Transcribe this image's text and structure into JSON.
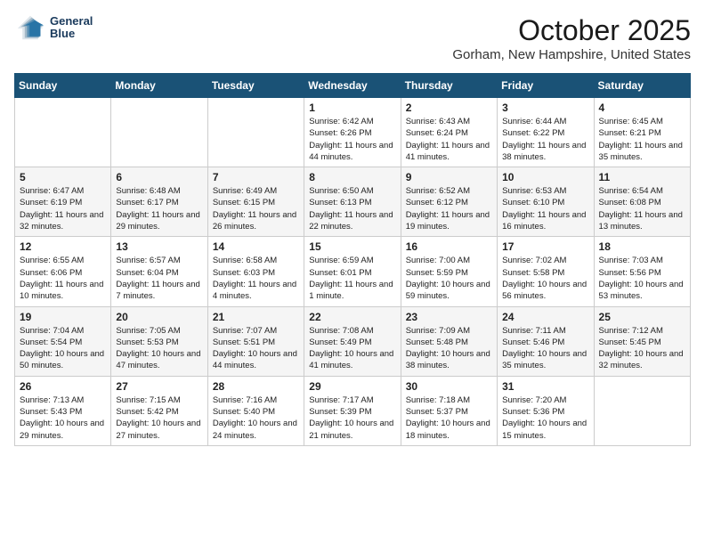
{
  "header": {
    "logo_line1": "General",
    "logo_line2": "Blue",
    "month": "October 2025",
    "location": "Gorham, New Hampshire, United States"
  },
  "weekdays": [
    "Sunday",
    "Monday",
    "Tuesday",
    "Wednesday",
    "Thursday",
    "Friday",
    "Saturday"
  ],
  "weeks": [
    [
      {
        "day": "",
        "sunrise": "",
        "sunset": "",
        "daylight": ""
      },
      {
        "day": "",
        "sunrise": "",
        "sunset": "",
        "daylight": ""
      },
      {
        "day": "",
        "sunrise": "",
        "sunset": "",
        "daylight": ""
      },
      {
        "day": "1",
        "sunrise": "Sunrise: 6:42 AM",
        "sunset": "Sunset: 6:26 PM",
        "daylight": "Daylight: 11 hours and 44 minutes."
      },
      {
        "day": "2",
        "sunrise": "Sunrise: 6:43 AM",
        "sunset": "Sunset: 6:24 PM",
        "daylight": "Daylight: 11 hours and 41 minutes."
      },
      {
        "day": "3",
        "sunrise": "Sunrise: 6:44 AM",
        "sunset": "Sunset: 6:22 PM",
        "daylight": "Daylight: 11 hours and 38 minutes."
      },
      {
        "day": "4",
        "sunrise": "Sunrise: 6:45 AM",
        "sunset": "Sunset: 6:21 PM",
        "daylight": "Daylight: 11 hours and 35 minutes."
      }
    ],
    [
      {
        "day": "5",
        "sunrise": "Sunrise: 6:47 AM",
        "sunset": "Sunset: 6:19 PM",
        "daylight": "Daylight: 11 hours and 32 minutes."
      },
      {
        "day": "6",
        "sunrise": "Sunrise: 6:48 AM",
        "sunset": "Sunset: 6:17 PM",
        "daylight": "Daylight: 11 hours and 29 minutes."
      },
      {
        "day": "7",
        "sunrise": "Sunrise: 6:49 AM",
        "sunset": "Sunset: 6:15 PM",
        "daylight": "Daylight: 11 hours and 26 minutes."
      },
      {
        "day": "8",
        "sunrise": "Sunrise: 6:50 AM",
        "sunset": "Sunset: 6:13 PM",
        "daylight": "Daylight: 11 hours and 22 minutes."
      },
      {
        "day": "9",
        "sunrise": "Sunrise: 6:52 AM",
        "sunset": "Sunset: 6:12 PM",
        "daylight": "Daylight: 11 hours and 19 minutes."
      },
      {
        "day": "10",
        "sunrise": "Sunrise: 6:53 AM",
        "sunset": "Sunset: 6:10 PM",
        "daylight": "Daylight: 11 hours and 16 minutes."
      },
      {
        "day": "11",
        "sunrise": "Sunrise: 6:54 AM",
        "sunset": "Sunset: 6:08 PM",
        "daylight": "Daylight: 11 hours and 13 minutes."
      }
    ],
    [
      {
        "day": "12",
        "sunrise": "Sunrise: 6:55 AM",
        "sunset": "Sunset: 6:06 PM",
        "daylight": "Daylight: 11 hours and 10 minutes."
      },
      {
        "day": "13",
        "sunrise": "Sunrise: 6:57 AM",
        "sunset": "Sunset: 6:04 PM",
        "daylight": "Daylight: 11 hours and 7 minutes."
      },
      {
        "day": "14",
        "sunrise": "Sunrise: 6:58 AM",
        "sunset": "Sunset: 6:03 PM",
        "daylight": "Daylight: 11 hours and 4 minutes."
      },
      {
        "day": "15",
        "sunrise": "Sunrise: 6:59 AM",
        "sunset": "Sunset: 6:01 PM",
        "daylight": "Daylight: 11 hours and 1 minute."
      },
      {
        "day": "16",
        "sunrise": "Sunrise: 7:00 AM",
        "sunset": "Sunset: 5:59 PM",
        "daylight": "Daylight: 10 hours and 59 minutes."
      },
      {
        "day": "17",
        "sunrise": "Sunrise: 7:02 AM",
        "sunset": "Sunset: 5:58 PM",
        "daylight": "Daylight: 10 hours and 56 minutes."
      },
      {
        "day": "18",
        "sunrise": "Sunrise: 7:03 AM",
        "sunset": "Sunset: 5:56 PM",
        "daylight": "Daylight: 10 hours and 53 minutes."
      }
    ],
    [
      {
        "day": "19",
        "sunrise": "Sunrise: 7:04 AM",
        "sunset": "Sunset: 5:54 PM",
        "daylight": "Daylight: 10 hours and 50 minutes."
      },
      {
        "day": "20",
        "sunrise": "Sunrise: 7:05 AM",
        "sunset": "Sunset: 5:53 PM",
        "daylight": "Daylight: 10 hours and 47 minutes."
      },
      {
        "day": "21",
        "sunrise": "Sunrise: 7:07 AM",
        "sunset": "Sunset: 5:51 PM",
        "daylight": "Daylight: 10 hours and 44 minutes."
      },
      {
        "day": "22",
        "sunrise": "Sunrise: 7:08 AM",
        "sunset": "Sunset: 5:49 PM",
        "daylight": "Daylight: 10 hours and 41 minutes."
      },
      {
        "day": "23",
        "sunrise": "Sunrise: 7:09 AM",
        "sunset": "Sunset: 5:48 PM",
        "daylight": "Daylight: 10 hours and 38 minutes."
      },
      {
        "day": "24",
        "sunrise": "Sunrise: 7:11 AM",
        "sunset": "Sunset: 5:46 PM",
        "daylight": "Daylight: 10 hours and 35 minutes."
      },
      {
        "day": "25",
        "sunrise": "Sunrise: 7:12 AM",
        "sunset": "Sunset: 5:45 PM",
        "daylight": "Daylight: 10 hours and 32 minutes."
      }
    ],
    [
      {
        "day": "26",
        "sunrise": "Sunrise: 7:13 AM",
        "sunset": "Sunset: 5:43 PM",
        "daylight": "Daylight: 10 hours and 29 minutes."
      },
      {
        "day": "27",
        "sunrise": "Sunrise: 7:15 AM",
        "sunset": "Sunset: 5:42 PM",
        "daylight": "Daylight: 10 hours and 27 minutes."
      },
      {
        "day": "28",
        "sunrise": "Sunrise: 7:16 AM",
        "sunset": "Sunset: 5:40 PM",
        "daylight": "Daylight: 10 hours and 24 minutes."
      },
      {
        "day": "29",
        "sunrise": "Sunrise: 7:17 AM",
        "sunset": "Sunset: 5:39 PM",
        "daylight": "Daylight: 10 hours and 21 minutes."
      },
      {
        "day": "30",
        "sunrise": "Sunrise: 7:18 AM",
        "sunset": "Sunset: 5:37 PM",
        "daylight": "Daylight: 10 hours and 18 minutes."
      },
      {
        "day": "31",
        "sunrise": "Sunrise: 7:20 AM",
        "sunset": "Sunset: 5:36 PM",
        "daylight": "Daylight: 10 hours and 15 minutes."
      },
      {
        "day": "",
        "sunrise": "",
        "sunset": "",
        "daylight": ""
      }
    ]
  ]
}
